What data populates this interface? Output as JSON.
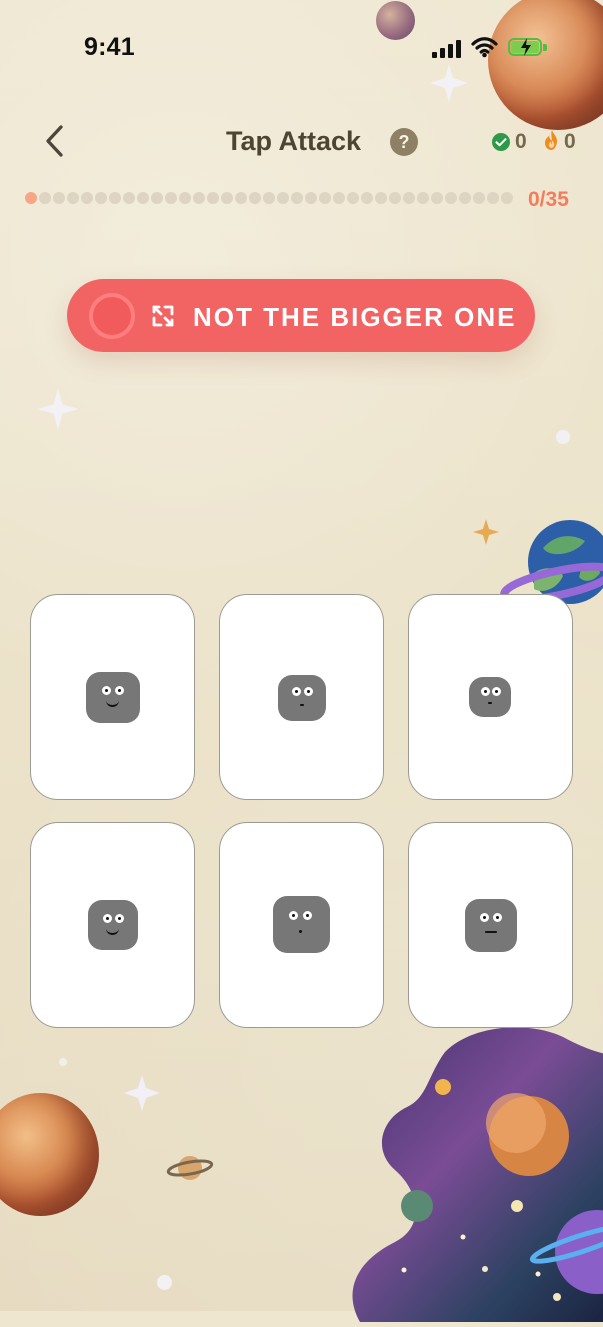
{
  "status_bar": {
    "time": "9:41"
  },
  "header": {
    "title": "Tap Attack",
    "help_label": "?",
    "correct_count": "0",
    "streak_count": "0"
  },
  "progress": {
    "text": "0/35",
    "current": 0,
    "total": 35
  },
  "instruction": {
    "text": "NOT THE BIGGER ONE"
  },
  "cards": [
    {
      "expression": "smile",
      "size": "large"
    },
    {
      "expression": "tiny",
      "size": "medium"
    },
    {
      "expression": "tiny",
      "size": "small"
    },
    {
      "expression": "smile",
      "size": "medium"
    },
    {
      "expression": "dot",
      "size": "large"
    },
    {
      "expression": "line",
      "size": "medium"
    }
  ],
  "colors": {
    "background": "#eee6cf",
    "instruction_pill": "#f26464",
    "progress_active": "#f7a785",
    "progress_inactive": "#ddd4c1",
    "progress_text": "#f27d5d",
    "title_text": "#4e4432",
    "face": "#777777"
  },
  "icons": {
    "back": "chevron-left-icon",
    "help": "question-mark-icon",
    "correct": "check-circle-icon",
    "streak": "flame-icon",
    "timer": "timer-ring-icon",
    "instruction": "shrink-arrows-icon",
    "signal": "signal-bars-icon",
    "wifi": "wifi-icon",
    "battery": "battery-charging-icon"
  }
}
